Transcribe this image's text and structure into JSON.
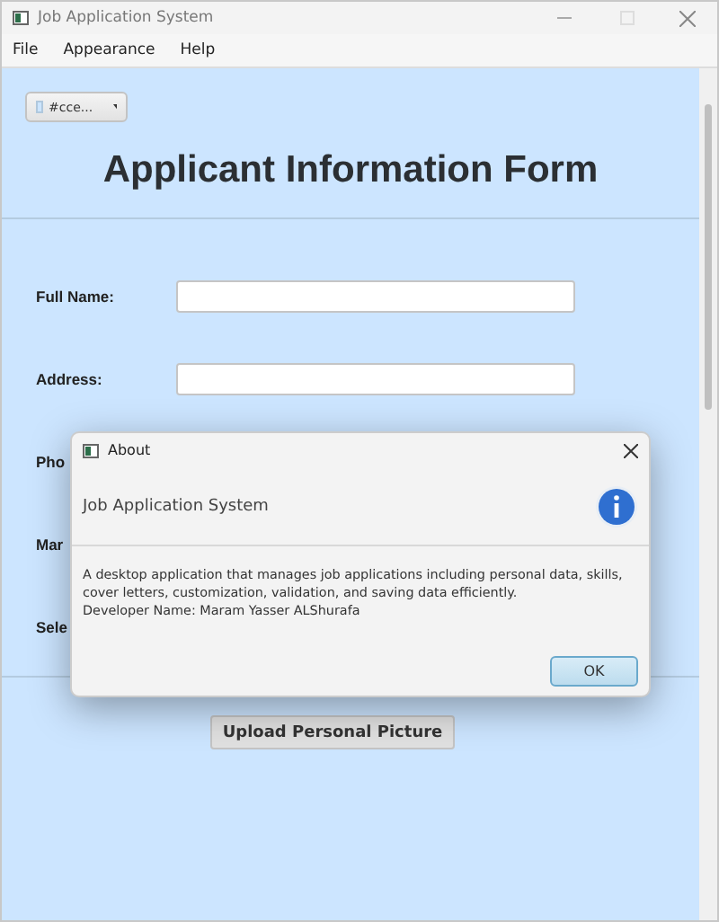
{
  "window": {
    "title": "Job Application System"
  },
  "menu": [
    "File",
    "Appearance",
    "Help"
  ],
  "color_picker": {
    "value": "#cce...",
    "color": "#cce5ff"
  },
  "form": {
    "title": "Applicant Information Form",
    "rows": [
      {
        "kind": "field",
        "label": "Full Name:"
      },
      {
        "kind": "field",
        "label": "Address:"
      },
      {
        "kind": "label",
        "label": "Pho"
      },
      {
        "kind": "label",
        "label": "Mar"
      },
      {
        "kind": "label",
        "label": "Sele"
      }
    ],
    "upload_button": "Upload Personal Picture"
  },
  "dialog": {
    "title": "About",
    "header": "Job Application System",
    "lines": [
      "A desktop application that manages job applications including personal data, skills, cover letters, customization, validation, and saving data efficiently.",
      "Developer Name: Maram Yasser ALShurafa"
    ],
    "button": "OK"
  }
}
